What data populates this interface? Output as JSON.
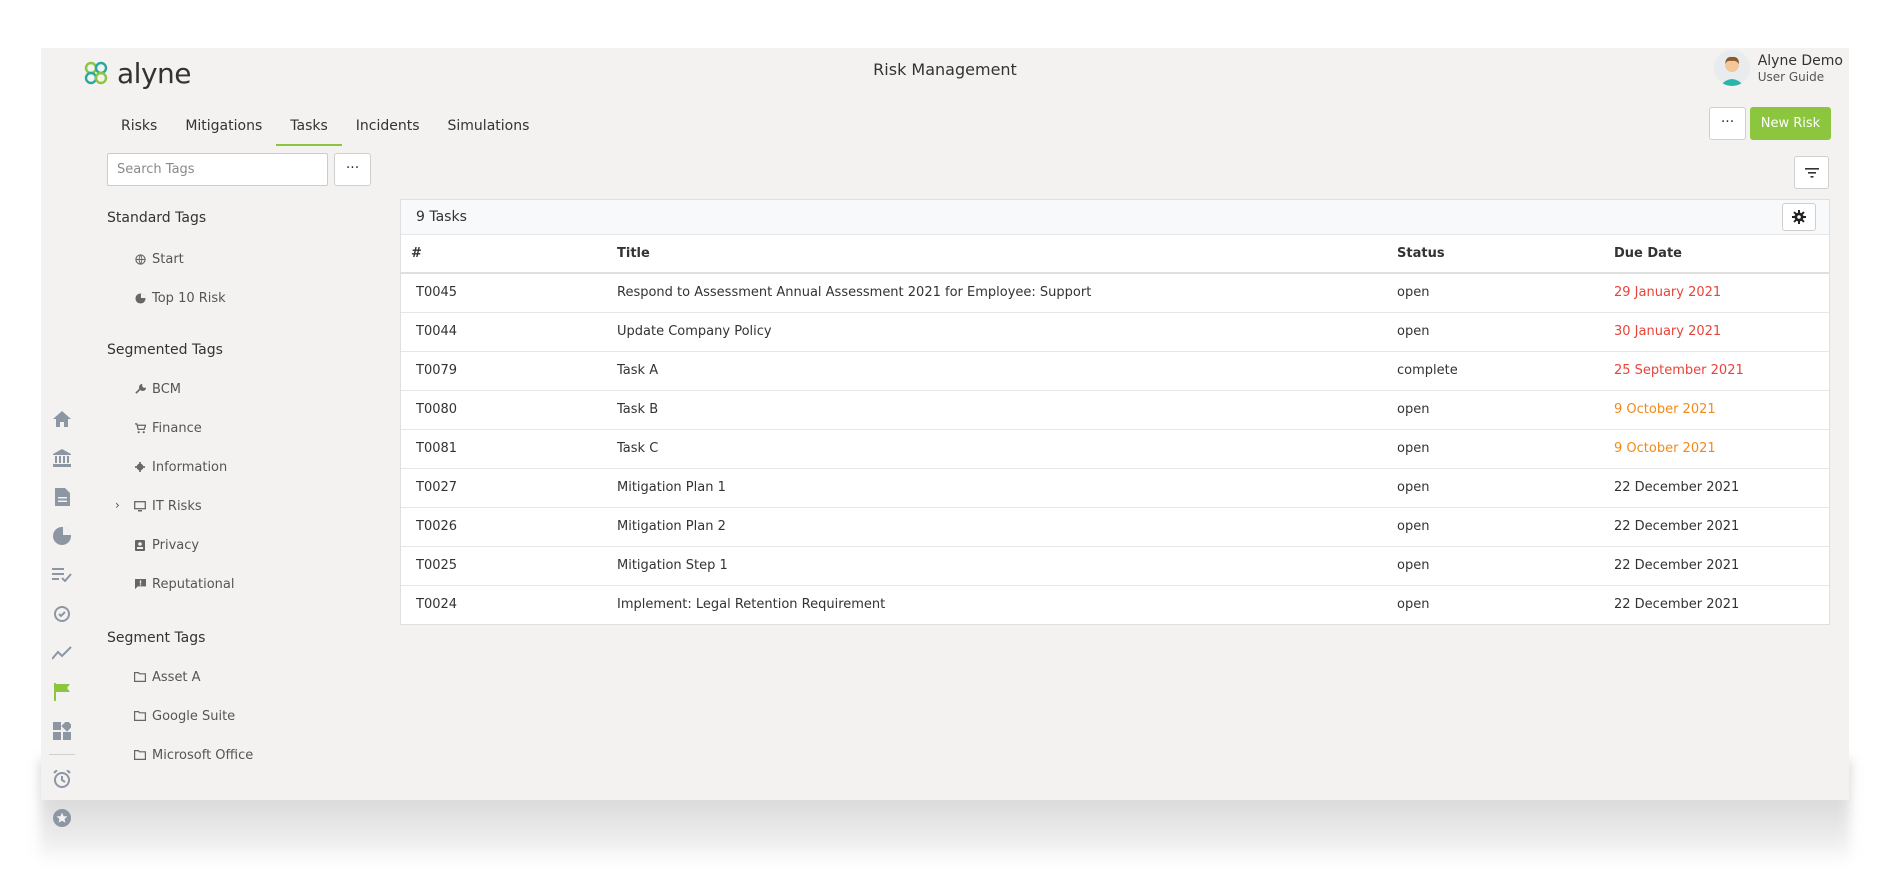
{
  "header": {
    "logo_text": "alyne",
    "app_title": "Risk Management",
    "user_name": "Alyne Demo",
    "user_role": "User Guide"
  },
  "tabs": [
    {
      "label": "Risks",
      "active": false
    },
    {
      "label": "Mitigations",
      "active": false
    },
    {
      "label": "Tasks",
      "active": true
    },
    {
      "label": "Incidents",
      "active": false
    },
    {
      "label": "Simulations",
      "active": false
    }
  ],
  "toolbar": {
    "more_label": "···",
    "new_risk_label": "New Risk"
  },
  "search": {
    "placeholder": "Search Tags",
    "more_label": "···"
  },
  "rail_icons": [
    "home-icon",
    "bank-icon",
    "document-icon",
    "pie-chart-icon",
    "checklist-icon",
    "sync-icon",
    "trend-icon",
    "flag-icon",
    "dashboard-icon",
    "alarm-icon",
    "star-icon"
  ],
  "tag_groups": {
    "standard": {
      "heading": "Standard Tags",
      "items": [
        {
          "label": "Start",
          "icon": "globe-icon"
        },
        {
          "label": "Top 10 Risk",
          "icon": "pie-icon"
        }
      ]
    },
    "segmented": {
      "heading": "Segmented Tags",
      "items": [
        {
          "label": "BCM",
          "icon": "wrench-icon"
        },
        {
          "label": "Finance",
          "icon": "cart-icon"
        },
        {
          "label": "Information",
          "icon": "gear-small-icon"
        },
        {
          "label": "IT Risks",
          "icon": "monitor-icon"
        },
        {
          "label": "Privacy",
          "icon": "badge-icon"
        },
        {
          "label": "Reputational",
          "icon": "comment-icon"
        }
      ]
    },
    "segment": {
      "heading": "Segment Tags",
      "items": [
        {
          "label": "Asset A",
          "icon": "folder-icon"
        },
        {
          "label": "Google Suite",
          "icon": "folder-icon"
        },
        {
          "label": "Microsoft Office",
          "icon": "folder-icon"
        }
      ]
    }
  },
  "table": {
    "count_label": "9 Tasks",
    "columns": [
      "#",
      "Title",
      "Status",
      "Due Date"
    ],
    "rows": [
      {
        "id": "T0045",
        "title": "Respond to Assessment Annual Assessment 2021 for Employee: Support",
        "status": "open",
        "due": "29 January 2021",
        "due_state": "overdue"
      },
      {
        "id": "T0044",
        "title": "Update Company Policy",
        "status": "open",
        "due": "30 January 2021",
        "due_state": "overdue"
      },
      {
        "id": "T0079",
        "title": "Task A",
        "status": "complete",
        "due": "25 September 2021",
        "due_state": "overdue"
      },
      {
        "id": "T0080",
        "title": "Task B",
        "status": "open",
        "due": "9 October 2021",
        "due_state": "soon"
      },
      {
        "id": "T0081",
        "title": "Task C",
        "status": "open",
        "due": "9 October 2021",
        "due_state": "soon"
      },
      {
        "id": "T0027",
        "title": "Mitigation Plan 1",
        "status": "open",
        "due": "22 December 2021",
        "due_state": "normal"
      },
      {
        "id": "T0026",
        "title": "Mitigation Plan 2",
        "status": "open",
        "due": "22 December 2021",
        "due_state": "normal"
      },
      {
        "id": "T0025",
        "title": "Mitigation Step 1",
        "status": "open",
        "due": "22 December 2021",
        "due_state": "normal"
      },
      {
        "id": "T0024",
        "title": "Implement: Legal Retention Requirement",
        "status": "open",
        "due": "22 December 2021",
        "due_state": "normal"
      }
    ]
  },
  "colors": {
    "accent": "#8cc63f",
    "overdue": "#e8443a",
    "soon": "#f28a1a",
    "icon_gray": "#8c97a3"
  }
}
